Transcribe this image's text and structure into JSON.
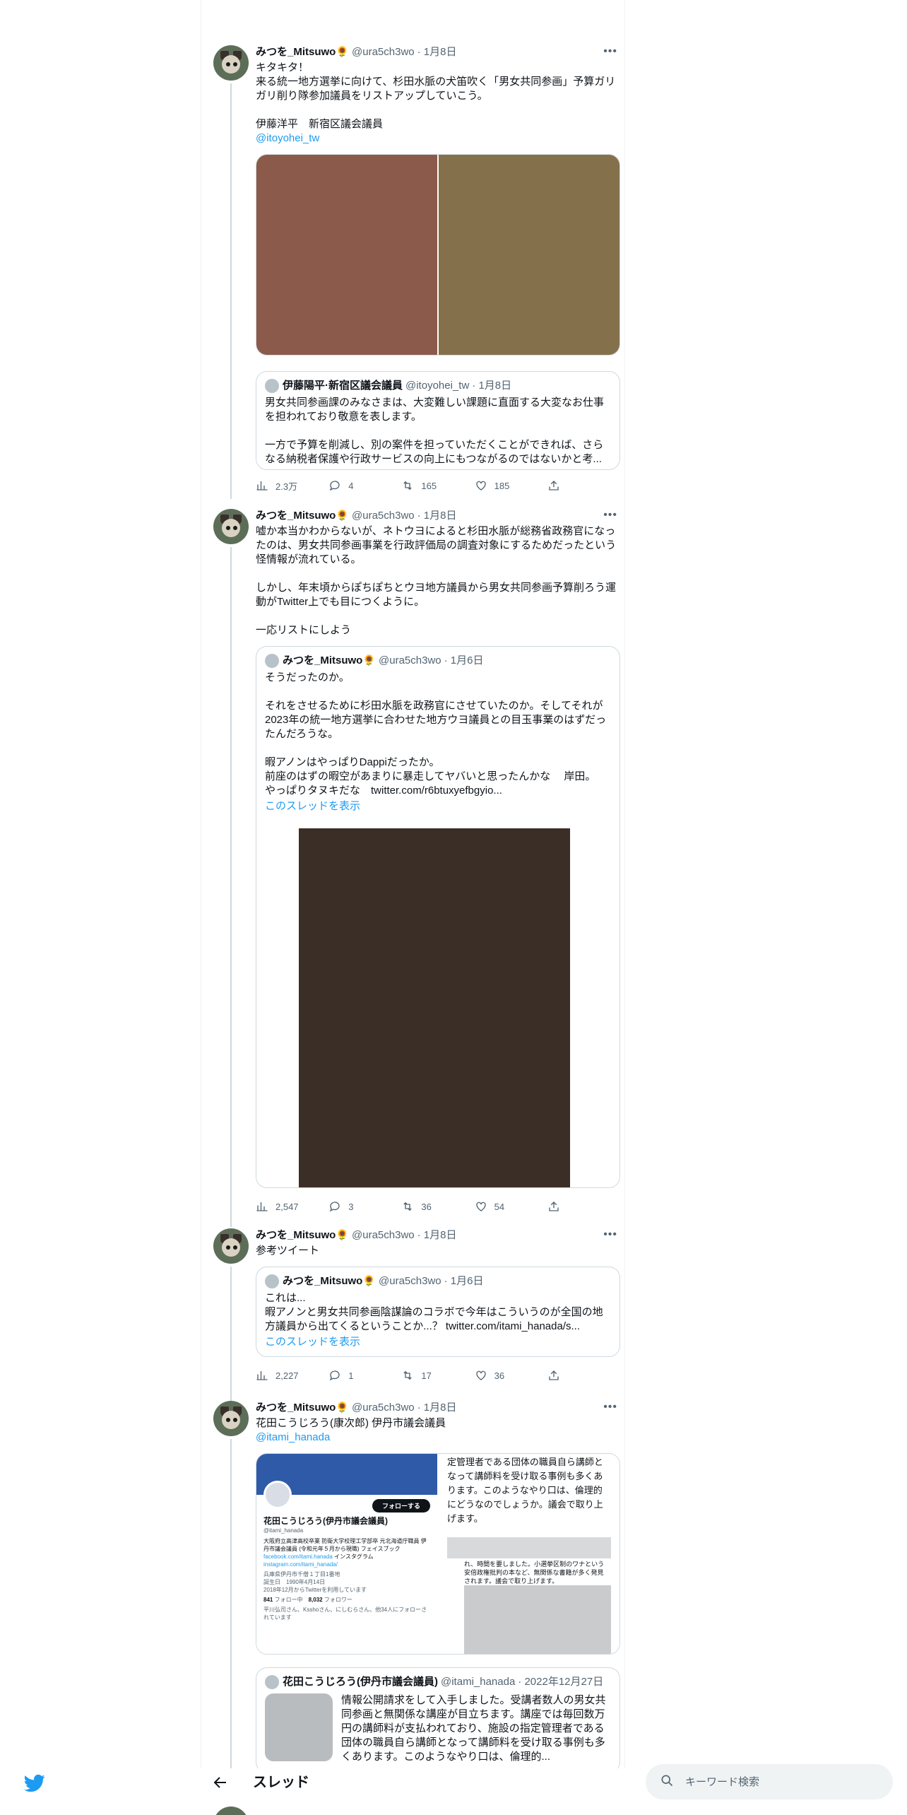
{
  "colors": {
    "accent": "#1d9bf0",
    "text": "#0f1419",
    "muted": "#536471",
    "border": "#cfd9de"
  },
  "tweets": [
    {
      "name": "みつを_Mitsuwo🌻",
      "handle": "@ura5ch3wo",
      "date": "· 1月8日",
      "text": "キタキタ！\n来る統一地方選挙に向けて、杉田水脈の犬笛吹く「男女共同参画」予算ガリガリ削り隊参加議員をリストアップしていこう。\n\n伊藤洋平　新宿区議会議員",
      "link": "@itoyohei_tw",
      "quote": {
        "name": "伊藤陽平·新宿区議会議員",
        "handle": "@itoyohei_tw",
        "date": "· 1月8日",
        "text": "男女共同参画課のみなさまは、大変難しい課題に直面する大変なお仕事を担われており敬意を表します。\n\n一方で予算を削減し、別の案件を担っていただくことができれば、さらなる納税者保護や行政サービスの向上にもつながるのではないかと考..."
      },
      "stats": {
        "views": "2.3万",
        "replies": "4",
        "retweets": "165",
        "likes": "185"
      }
    },
    {
      "name": "みつを_Mitsuwo🌻",
      "handle": "@ura5ch3wo",
      "date": "· 1月8日",
      "text": "嘘か本当かわからないが、ネトウヨによると杉田水脈が総務省政務官になったのは、男女共同参画事業を行政評価局の調査対象にするためだったという怪情報が流れている。\n\nしかし、年末頃からぽちぽちとウヨ地方議員から男女共同参画予算削ろう運動がTwitter上でも目につくように。\n\n一応リストにしよう",
      "quote": {
        "name": "みつを_Mitsuwo🌻",
        "handle": "@ura5ch3wo",
        "date": "· 1月6日",
        "text": "そうだったのか。\n\nそれをさせるために杉田水脈を政務官にさせていたのか。そしてそれが2023年の統一地方選挙に合わせた地方ウヨ議員との目玉事業のはずだったんだろうな。\n\n暇アノンはやっぱりDappiだったか。\n前座のはずの暇空があまりに暴走してヤバいと思ったんかな　 岸田。\nやっぱりタヌキだな　twitter.com/r6btuxyefbgyio...",
        "show_thread": "このスレッドを表示"
      },
      "stats": {
        "views": "2,547",
        "replies": "3",
        "retweets": "36",
        "likes": "54"
      }
    },
    {
      "name": "みつを_Mitsuwo🌻",
      "handle": "@ura5ch3wo",
      "date": "· 1月8日",
      "text": "参考ツイート",
      "quote": {
        "name": "みつを_Mitsuwo🌻",
        "handle": "@ura5ch3wo",
        "date": "· 1月6日",
        "text": "これは...\n暇アノンと男女共同参画陰謀論のコラボで今年はこういうのが全国の地方議員から出てくるということか...？ twitter.com/itami_hanada/s...",
        "show_thread": "このスレッドを表示"
      },
      "stats": {
        "views": "2,227",
        "replies": "1",
        "retweets": "17",
        "likes": "36"
      }
    },
    {
      "name": "みつを_Mitsuwo🌻",
      "handle": "@ura5ch3wo",
      "date": "· 1月8日",
      "text": "花田こうじろう(康次郎) 伊丹市議会議員",
      "link": "@itami_hanada",
      "profile_card": {
        "follow_label": "フォローする",
        "name": "花田こうじろう(伊丹市議会議員)",
        "handle": "@itami_hanada",
        "bio": "大阪府立高津高校卒業 防衛大学校理工学部卒 元北海道庁職員 伊丹市議会議員 (令和元年５月から現職) フェイスブック",
        "bio_link1": "facebook.com/itami.hanada",
        "bio_mid": "インスタグラム",
        "bio_link2": "instagram.com/itami_hanada/",
        "location": "兵庫県伊丹市千僧１丁目1番地",
        "birthday": "誕生日　1990年4月14日",
        "joined": "2018年12月からTwitterを利用しています",
        "following": "841",
        "following_label": "フォロー中",
        "followers": "8,032",
        "followers_label": "フォロワー",
        "followed_by": "平川弘司さん、Ksshoさん、にしむらさん、他34人にフォローされています"
      },
      "side_text": "定管理者である団体の職員自ら講師となって講師料を受け取る事例も多くあります。このようなやり口は、倫理的にどうなのでしょうか。議会で取り上げます。",
      "side_text2": "れ、時間を要しました。小選挙区制のワナという安倍政権批判の本など、無関係な書籍が多く発見されます。議会で取り上げます。",
      "quote": {
        "name": "花田こうじろう(伊丹市議会議員)",
        "handle": "@itami_hanada",
        "date": "· 2022年12月27日",
        "text": "情報公開請求をして入手しました。受講者数人の男女共同参画と無関係な講座が目立ちます。講座では毎回数万円の講師料が支払われており、施設の指定管理者である団体の職員自ら講師となって講師料を受け取る事例も多くあります。このようなやり口は、倫理的..."
      }
    }
  ],
  "bottom": {
    "title": "スレッド",
    "search_placeholder": "キーワード検索"
  }
}
